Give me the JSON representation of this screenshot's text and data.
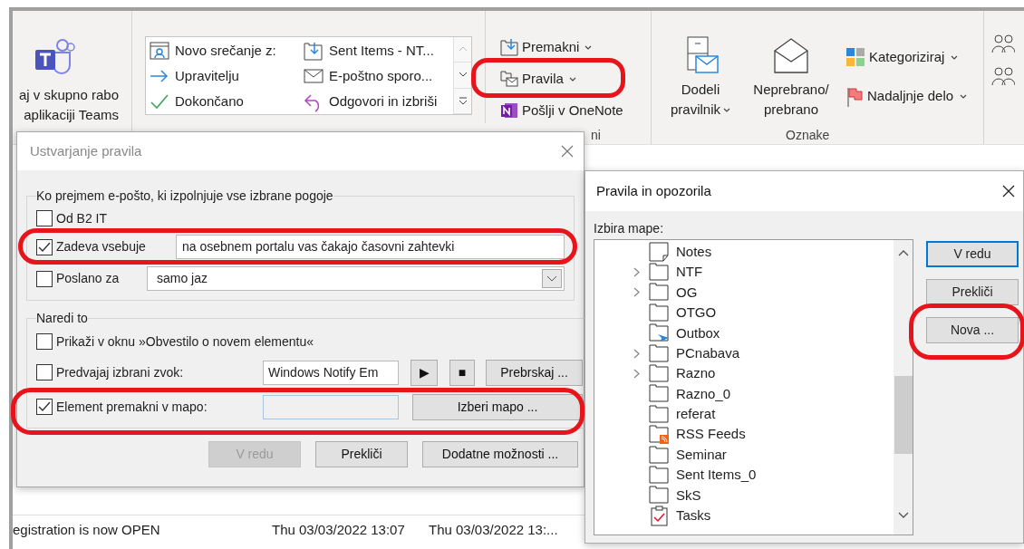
{
  "ribbon": {
    "teams_label": [
      "aj v skupno rabo",
      "aplikaciji Teams"
    ],
    "quick_steps": [
      {
        "label": "Novo srečanje z:",
        "kind": "meeting"
      },
      {
        "label": "Sent Items - NT...",
        "kind": "move"
      },
      {
        "label": "Upravitelju",
        "kind": "forward"
      },
      {
        "label": "E-poštno sporo...",
        "kind": "mail"
      },
      {
        "label": "Dokončano",
        "kind": "done"
      },
      {
        "label": "Odgovori in izbriši",
        "kind": "reply"
      }
    ],
    "move_group": {
      "items": [
        {
          "label": "Premakni",
          "kind": "move",
          "dropdown": true
        },
        {
          "label": "Pravila",
          "kind": "rules",
          "dropdown": true
        },
        {
          "label": "Pošlji v OneNote",
          "kind": "onenote",
          "dropdown": false
        }
      ],
      "label": "ni"
    },
    "tags_group": {
      "assign_policy": [
        "Dodeli",
        "pravilnik"
      ],
      "unread": [
        "Neprebrano/",
        "prebrano"
      ],
      "categorize": "Kategoriziraj",
      "follow_up": "Nadaljnje delo",
      "label": "Oznake"
    }
  },
  "mail_row": {
    "subject": "egistration is now OPEN",
    "received": "Thu 03/03/2022 13:07",
    "sent": "Thu 03/03/2022 13:..."
  },
  "create_rule_dialog": {
    "title": "Ustvarjanje pravila",
    "conditions": {
      "legend": "Ko prejmem e-pošto, ki izpolnjuje vse izbrane pogoje",
      "rows": [
        {
          "kind": "check",
          "label": "Od B2 IT",
          "checked": false
        },
        {
          "kind": "text",
          "label": "Zadeva vsebuje",
          "checked": true,
          "value": "na osebnem portalu vas čakajo časovni zahtevki"
        },
        {
          "kind": "select",
          "label": "Poslano za",
          "checked": false,
          "value": "samo jaz"
        }
      ]
    },
    "actions": {
      "legend": "Naredi to",
      "rows": [
        {
          "kind": "check",
          "label": "Prikaži v oknu »Obvestilo o novem elementu«",
          "checked": false
        },
        {
          "kind": "sound",
          "label": "Predvajaj izbrani zvok:",
          "checked": false,
          "value": "Windows Notify Em",
          "play": "▶",
          "stop": "■",
          "button": "Prebrskaj ..."
        },
        {
          "kind": "folder",
          "label": "Element premakni v mapo:",
          "checked": true,
          "button": "Izberi mapo ..."
        }
      ]
    },
    "buttons": [
      {
        "label": "V redu",
        "disabled": true
      },
      {
        "label": "Prekliči",
        "disabled": false
      },
      {
        "label": "Dodatne možnosti ...",
        "disabled": false
      }
    ]
  },
  "rules_dialog": {
    "title": "Pravila in opozorila",
    "folder_label": "Izbira mape:",
    "folders": [
      {
        "name": "Notes",
        "kind": "notes",
        "expandable": false
      },
      {
        "name": "NTF",
        "kind": "folder",
        "expandable": true
      },
      {
        "name": "OG",
        "kind": "folder",
        "expandable": true
      },
      {
        "name": "OTGO",
        "kind": "folder",
        "expandable": false
      },
      {
        "name": "Outbox",
        "kind": "outbox",
        "expandable": false
      },
      {
        "name": "PCnabava",
        "kind": "folder",
        "expandable": true
      },
      {
        "name": "Razno",
        "kind": "folder",
        "expandable": true
      },
      {
        "name": "Razno_0",
        "kind": "folder",
        "expandable": false
      },
      {
        "name": "referat",
        "kind": "folder",
        "expandable": false
      },
      {
        "name": "RSS Feeds",
        "kind": "rss",
        "expandable": false
      },
      {
        "name": "Seminar",
        "kind": "folder",
        "expandable": false
      },
      {
        "name": "Sent Items_0",
        "kind": "folder",
        "expandable": false
      },
      {
        "name": "SkS",
        "kind": "folder",
        "expandable": false
      },
      {
        "name": "Tasks",
        "kind": "tasks",
        "expandable": false
      }
    ],
    "buttons": [
      {
        "label": "V redu",
        "default": true
      },
      {
        "label": "Prekliči",
        "default": false
      },
      {
        "label": "Nova ...",
        "default": false
      }
    ]
  }
}
